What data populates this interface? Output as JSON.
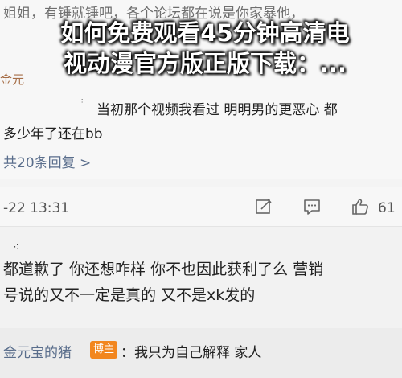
{
  "overlay": {
    "title_line1": "如何免费观看45分钟高清电",
    "title_line2": "视动漫官方版正版下载：..."
  },
  "header": {
    "faded_text": "姐姐，有锤就锤吧，各个论坛都在说是你家暴他，",
    "faded_name": "金元"
  },
  "comment1": {
    "line1": "当初那个视频我看过 明明男的更恶心 都",
    "line2": "多少年了还在bb",
    "replies_link": "共20条回复 >",
    "timestamp": "-22 13:31",
    "like_count": "61"
  },
  "comment2": {
    "line1": "都道歉了 你还想咋样 你不也因此获利了么 营销",
    "line2": "号说的又不一定是真的 又不是xk发的"
  },
  "reply": {
    "name": "金元宝的猪",
    "badge": "博主",
    "text": "：我只为自己解释 家人"
  },
  "colors": {
    "link": "#5a6e8c",
    "badge_bg": "#f2861e",
    "name_faded": "#a66e47"
  },
  "icons": [
    "edit-icon",
    "comment-icon",
    "thumbs-up-icon"
  ]
}
